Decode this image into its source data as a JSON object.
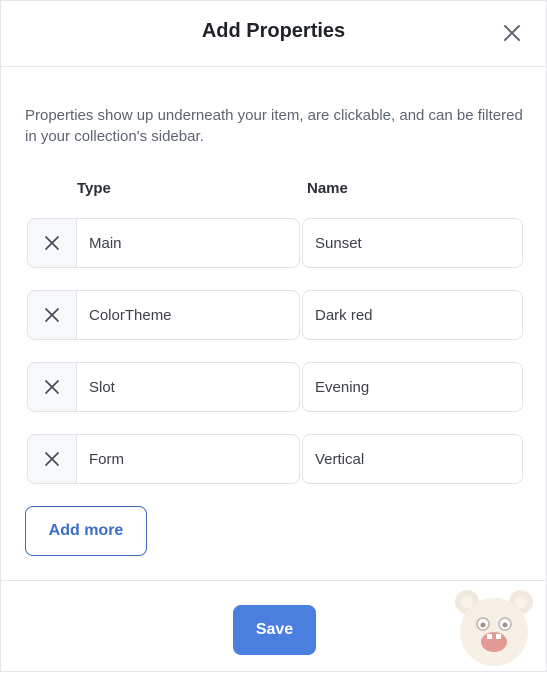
{
  "dialog": {
    "title": "Add Properties",
    "close_icon": "close-icon",
    "description": "Properties show up underneath your item, are clickable, and can be filtered in your collection's sidebar."
  },
  "columns": {
    "type": "Type",
    "name": "Name"
  },
  "properties": [
    {
      "type": "Main",
      "name": "Sunset"
    },
    {
      "type": "ColorTheme",
      "name": "Dark red"
    },
    {
      "type": "Slot",
      "name": "Evening"
    },
    {
      "type": "Form",
      "name": "Vertical"
    }
  ],
  "actions": {
    "add_more": "Add more",
    "save": "Save"
  },
  "colors": {
    "accent": "#4a7fe0",
    "accent_text": "#3b6fc7",
    "border": "#dfe2e6"
  },
  "icons": {
    "remove": "x-icon",
    "watermark": "bear-mascot-icon"
  }
}
